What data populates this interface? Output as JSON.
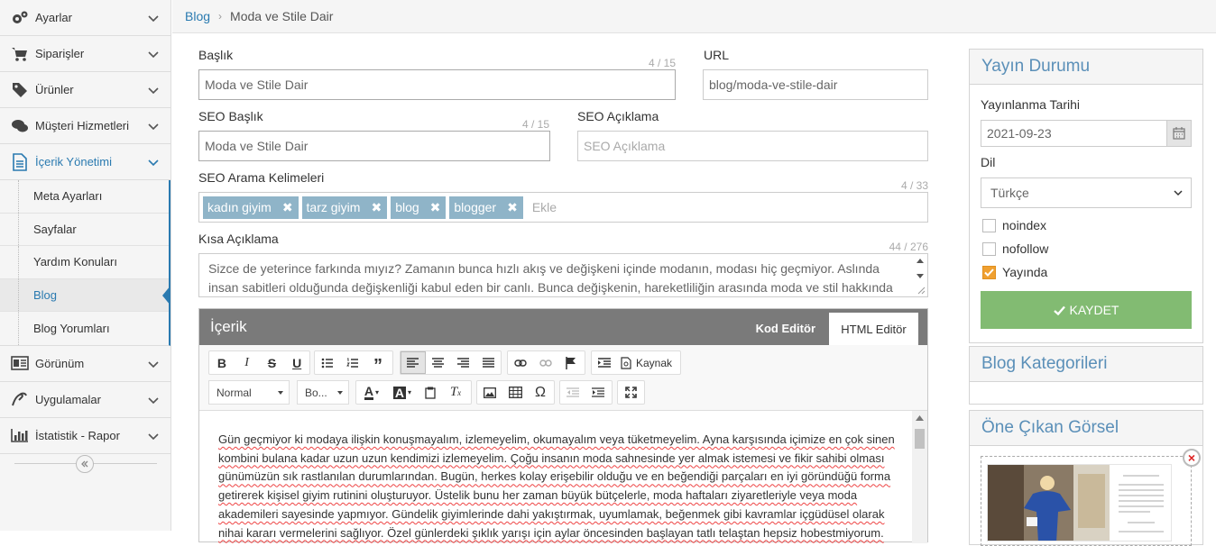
{
  "sidebar": {
    "items": [
      {
        "label": "Ayarlar",
        "icon": "gears-icon"
      },
      {
        "label": "Siparişler",
        "icon": "cart-icon"
      },
      {
        "label": "Ürünler",
        "icon": "tag-icon"
      },
      {
        "label": "Müşteri Hizmetleri",
        "icon": "chat-icon"
      },
      {
        "label": "İçerik Yönetimi",
        "icon": "document-icon"
      },
      {
        "label": "Görünüm",
        "icon": "layout-icon"
      },
      {
        "label": "Uygulamalar",
        "icon": "hands-icon"
      },
      {
        "label": "İstatistik - Rapor",
        "icon": "bar-chart-icon"
      }
    ],
    "submenu": [
      "Meta Ayarları",
      "Sayfalar",
      "Yardım Konuları",
      "Blog",
      "Blog Yorumları"
    ]
  },
  "breadcrumb": {
    "root": "Blog",
    "current": "Moda ve Stile Dair"
  },
  "form": {
    "title_label": "Başlık",
    "title_value": "Moda ve Stile Dair",
    "title_counter": "4 / 15",
    "url_label": "URL",
    "url_value": "blog/moda-ve-stile-dair",
    "seo_title_label": "SEO Başlık",
    "seo_title_value": "Moda ve Stile Dair",
    "seo_title_counter": "4 / 15",
    "seo_desc_label": "SEO Açıklama",
    "seo_desc_placeholder": "SEO Açıklama",
    "keywords_label": "SEO Arama Kelimeleri",
    "keywords_counter": "4 / 33",
    "keywords": [
      "kadın giyim",
      "tarz giyim",
      "blog",
      "blogger"
    ],
    "keywords_placeholder": "Ekle",
    "short_desc_label": "Kısa Açıklama",
    "short_desc_counter": "44 / 276",
    "short_desc_value": "Sizce de yeterince farkında mıyız? Zamanın bunca hızlı akış ve değişkeni içinde modanın, modası hiç geçmiyor. Aslında insan sabitleri olduğunda değişkenliği kabul eden bir canlı. Bunca değişkenin, hareketliliğin arasında moda ve stil hakkında"
  },
  "editor": {
    "title": "İçerik",
    "tab_code": "Kod Editör",
    "tab_html": "HTML Editör",
    "source_label": "Kaynak",
    "format_combo": "Normal",
    "font_combo": "Bo...",
    "content": "Gün geçmiyor ki modaya ilişkin konuşmayalım, izlemeyelim, okumayalım veya tüketmeyelim. Ayna karşısında içimize en çok sinen kombini bulana kadar uzun uzun kendimizi izlemeyelim.  Çoğu insanın moda sahnesinde yer almak istemesi ve fikir sahibi olması günümüzün sık rastlanılan durumlarından. Bugün, herkes kolay erişebilir olduğu ve en beğendiği parçaları en iyi göründüğü forma getirerek kişisel giyim rutinini oluşturuyor. Üstelik bunu her zaman büyük bütçelerle, moda haftaları ziyaretleriyle veya moda akademileri sayesinde yapmıyor. Gündelik giyimlerinde dahi yakıştırmak, uyumlamak, beğenmek gibi kavramlar içgüdüsel olarak nihai kararı vermelerini sağlıyor. Özel günlerdeki şıklık yarışı için aylar öncesinden başlayan tatlı telaştan hepsiz hobestmiyorum."
  },
  "publish": {
    "title": "Yayın Durumu",
    "date_label": "Yayınlanma Tarihi",
    "date_value": "2021-09-23",
    "lang_label": "Dil",
    "lang_value": "Türkçe",
    "noindex": "noindex",
    "nofollow": "nofollow",
    "published": "Yayında",
    "save": "KAYDET"
  },
  "categories": {
    "title": "Blog Kategorileri"
  },
  "featured": {
    "title": "Öne Çıkan Görsel",
    "remove": "×"
  },
  "colors": {
    "accent": "#2a7ab0",
    "save": "#82bb72",
    "tag": "#8fb4c8",
    "panel_title": "#5a8fb8",
    "checkbox": "#f0a030"
  }
}
